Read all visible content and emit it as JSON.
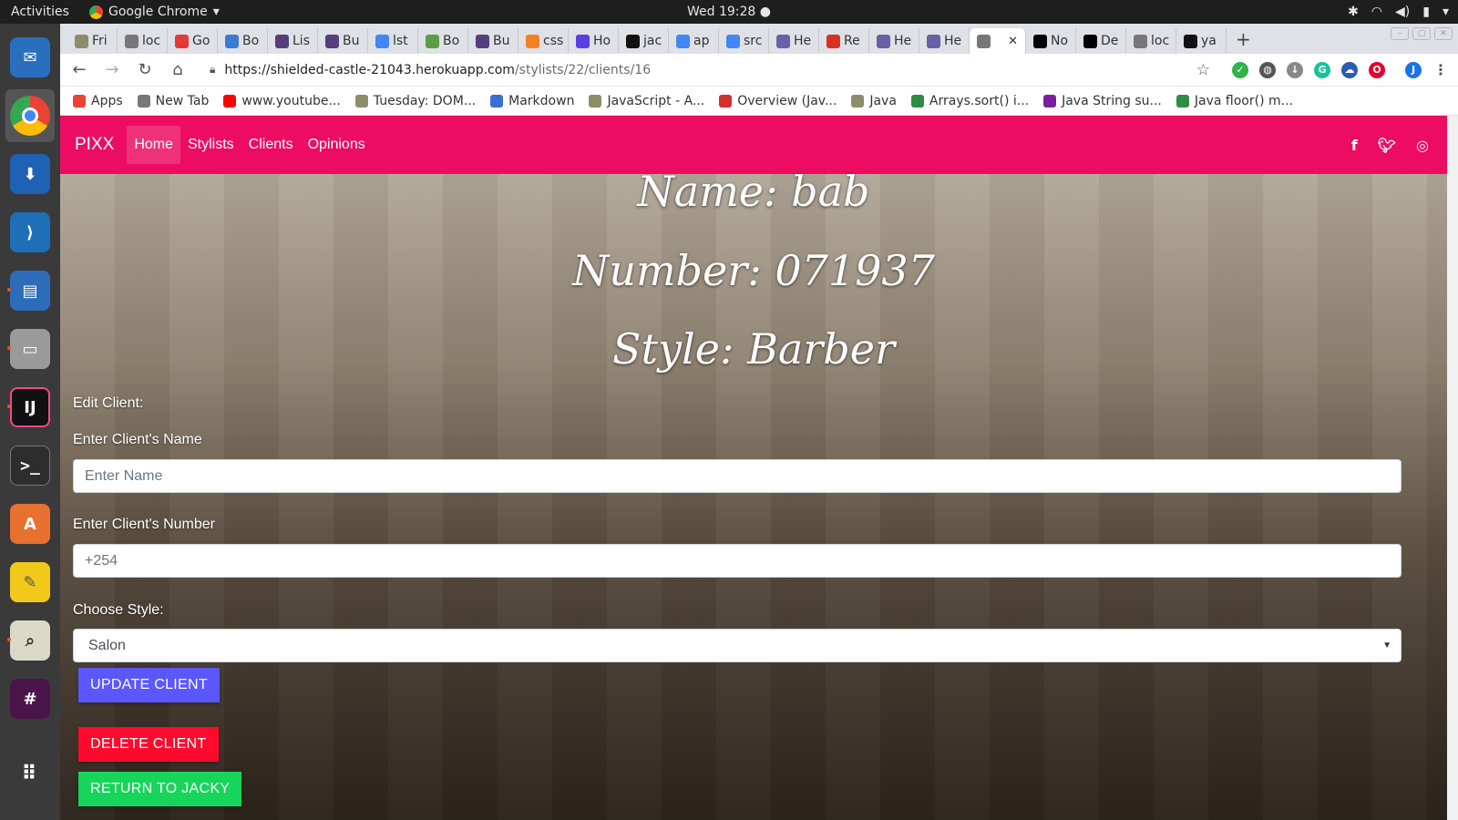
{
  "system": {
    "activities": "Activities",
    "app_name": "Google Chrome",
    "clock": "Wed 19:28 ●"
  },
  "tabs": [
    {
      "label": "Fri",
      "icon": "leaf-favicon",
      "color": "#8d8d6a"
    },
    {
      "label": "loc",
      "icon": "page-favicon",
      "color": "#777777"
    },
    {
      "label": "Go",
      "icon": "red-circle-favicon",
      "color": "#e53935"
    },
    {
      "label": "Bo",
      "icon": "mdn-favicon",
      "color": "#3a7bd5"
    },
    {
      "label": "Lis",
      "icon": "bootstrap-favicon",
      "color": "#563d7c"
    },
    {
      "label": "Bu",
      "icon": "bootstrap-favicon",
      "color": "#563d7c"
    },
    {
      "label": "lst",
      "icon": "google-favicon",
      "color": "#4285f4"
    },
    {
      "label": "Bo",
      "icon": "bo-favicon",
      "color": "#5a9e4a"
    },
    {
      "label": "Bu",
      "icon": "bootstrap-favicon",
      "color": "#563d7c"
    },
    {
      "label": "css",
      "icon": "stackoverflow-favicon",
      "color": "#f48024"
    },
    {
      "label": "Ho",
      "icon": "play-favicon",
      "color": "#5b3fe0"
    },
    {
      "label": "jac",
      "icon": "github-favicon",
      "color": "#111111"
    },
    {
      "label": "ap",
      "icon": "google-favicon",
      "color": "#4285f4"
    },
    {
      "label": "src",
      "icon": "google-favicon",
      "color": "#4285f4"
    },
    {
      "label": "He",
      "icon": "heroku-favicon",
      "color": "#6762a6"
    },
    {
      "label": "Re",
      "icon": "gmail-favicon",
      "color": "#d93025"
    },
    {
      "label": "He",
      "icon": "heroku-favicon",
      "color": "#6762a6"
    },
    {
      "label": "He",
      "icon": "heroku-favicon",
      "color": "#6762a6"
    },
    {
      "label": "",
      "icon": "page-favicon",
      "color": "#777777",
      "active": true
    },
    {
      "label": "No",
      "icon": "medium-favicon",
      "color": "#000000"
    },
    {
      "label": "De",
      "icon": "medium-favicon",
      "color": "#000000"
    },
    {
      "label": "loc",
      "icon": "page-favicon",
      "color": "#777777"
    },
    {
      "label": "ya",
      "icon": "github-favicon",
      "color": "#111111"
    }
  ],
  "address": {
    "host": "https://shielded-castle-21043.herokuapp.com",
    "path": "/stylists/22/clients/16"
  },
  "bookmarks": [
    {
      "label": "Apps",
      "icon": "apps-grid-icon",
      "color": "#ea4335"
    },
    {
      "label": "New Tab",
      "icon": "page-favicon",
      "color": "#777777"
    },
    {
      "label": "www.youtube...",
      "icon": "youtube-favicon",
      "color": "#ff0000"
    },
    {
      "label": "Tuesday: DOM...",
      "icon": "leaf-favicon",
      "color": "#8d8d6a"
    },
    {
      "label": "Markdown",
      "icon": "markdown-favicon",
      "color": "#3b6fd6"
    },
    {
      "label": "JavaScript - A...",
      "icon": "leaf-favicon",
      "color": "#8d8d6a"
    },
    {
      "label": "Overview (Jav...",
      "icon": "oracle-favicon",
      "color": "#d32f2f"
    },
    {
      "label": "Java",
      "icon": "leaf-favicon",
      "color": "#8d8d6a"
    },
    {
      "label": "Arrays.sort() i...",
      "icon": "gfg-favicon",
      "color": "#2f8d46"
    },
    {
      "label": "Java String su...",
      "icon": "javatpoint-favicon",
      "color": "#7b1fa2"
    },
    {
      "label": "Java floor() m...",
      "icon": "gfg-favicon",
      "color": "#2f8d46"
    }
  ],
  "site": {
    "brand": "PIXX",
    "nav": [
      "Home",
      "Stylists",
      "Clients",
      "Opinions"
    ],
    "accent": "#ec0d62"
  },
  "client": {
    "name_line": "Name: bab",
    "number_line": "Number: 071937",
    "style_line": "Style: Barber"
  },
  "form": {
    "heading": "Edit Client:",
    "name_label": "Enter Client's Name",
    "name_placeholder": "Enter Name",
    "number_label": "Enter Client's Number",
    "number_placeholder": "+254",
    "style_label": "Choose Style:",
    "style_selected": "Salon"
  },
  "buttons": {
    "update": {
      "label": "UPDATE CLIENT",
      "color": "#5b57ff"
    },
    "delete": {
      "label": "DELETE CLIENT",
      "color": "#ff0a2f"
    },
    "return": {
      "label": "RETURN TO JACKY",
      "color": "#17d45a"
    }
  }
}
